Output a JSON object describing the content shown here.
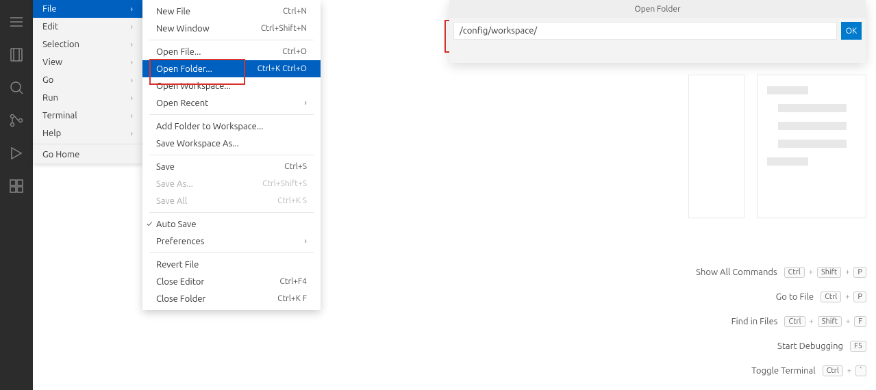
{
  "activityBar": {
    "items": [
      "menu",
      "explorer",
      "search",
      "sourceControl",
      "debug",
      "extensions"
    ]
  },
  "menubar": {
    "items": [
      {
        "label": "File",
        "selected": true,
        "hasSub": true
      },
      {
        "label": "Edit",
        "selected": false,
        "hasSub": true
      },
      {
        "label": "Selection",
        "selected": false,
        "hasSub": true
      },
      {
        "label": "View",
        "selected": false,
        "hasSub": true
      },
      {
        "label": "Go",
        "selected": false,
        "hasSub": true
      },
      {
        "label": "Run",
        "selected": false,
        "hasSub": true
      },
      {
        "label": "Terminal",
        "selected": false,
        "hasSub": true
      },
      {
        "label": "Help",
        "selected": false,
        "hasSub": true
      },
      {
        "sep": true
      },
      {
        "label": "Go Home",
        "selected": false,
        "hasSub": false
      }
    ]
  },
  "fileMenu": {
    "items": [
      {
        "label": "New File",
        "kbd": "Ctrl+N"
      },
      {
        "label": "New Window",
        "kbd": "Ctrl+Shift+N"
      },
      {
        "sep": true
      },
      {
        "label": "Open File...",
        "kbd": "Ctrl+O"
      },
      {
        "label": "Open Folder...",
        "kbd": "Ctrl+K Ctrl+O",
        "selected": true
      },
      {
        "label": "Open Workspace..."
      },
      {
        "label": "Open Recent",
        "submenu": true
      },
      {
        "sep": true
      },
      {
        "label": "Add Folder to Workspace..."
      },
      {
        "label": "Save Workspace As..."
      },
      {
        "sep": true
      },
      {
        "label": "Save",
        "kbd": "Ctrl+S"
      },
      {
        "label": "Save As...",
        "kbd": "Ctrl+Shift+S",
        "disabled": true
      },
      {
        "label": "Save All",
        "kbd": "Ctrl+K S",
        "disabled": true
      },
      {
        "sep": true
      },
      {
        "label": "Auto Save",
        "checked": true
      },
      {
        "label": "Preferences",
        "submenu": true
      },
      {
        "sep": true
      },
      {
        "label": "Revert File"
      },
      {
        "label": "Close Editor",
        "kbd": "Ctrl+F4"
      },
      {
        "label": "Close Folder",
        "kbd": "Ctrl+K F"
      }
    ]
  },
  "dialog": {
    "title": "Open Folder",
    "value": "/config/workspace/",
    "okLabel": "OK"
  },
  "hints": [
    {
      "label": "Show All Commands",
      "keys": [
        "Ctrl",
        "Shift",
        "P"
      ]
    },
    {
      "label": "Go to File",
      "keys": [
        "Ctrl",
        "P"
      ]
    },
    {
      "label": "Find in Files",
      "keys": [
        "Ctrl",
        "Shift",
        "F"
      ]
    },
    {
      "label": "Start Debugging",
      "keys": [
        "F5"
      ]
    },
    {
      "label": "Toggle Terminal",
      "keys": [
        "Ctrl",
        "`"
      ]
    }
  ]
}
